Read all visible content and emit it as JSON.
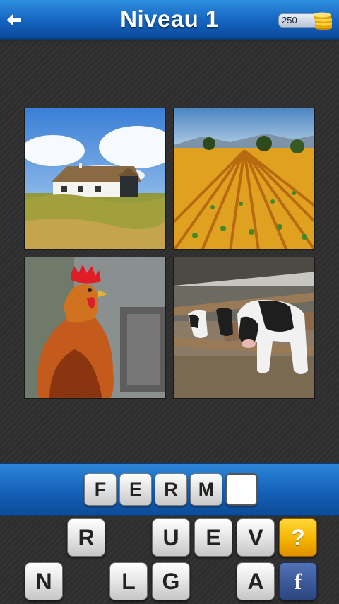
{
  "header": {
    "title": "Niveau 1",
    "coins": "250"
  },
  "answer": {
    "letters": [
      "F",
      "E",
      "R",
      "M",
      ""
    ]
  },
  "keyboard": {
    "row1": [
      "R",
      "",
      "U",
      "E",
      "V"
    ],
    "row2": [
      "N",
      "",
      "L",
      "G",
      "",
      "A"
    ],
    "hint_label": "?",
    "facebook_label": "f"
  },
  "colors": {
    "header": "#1464c0",
    "hint": "#f4b400",
    "facebook": "#3b5998"
  },
  "icons": [
    "back-arrow-icon",
    "coins-icon"
  ]
}
